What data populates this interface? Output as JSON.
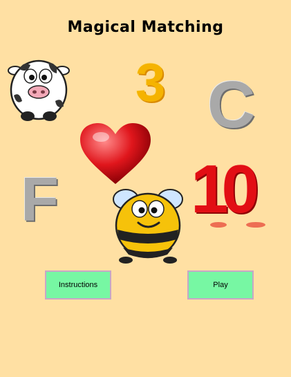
{
  "app": {
    "title": "Magical Matching"
  },
  "cards": {
    "number_three": "3",
    "letter_c": "C",
    "letter_f": "F",
    "number_ten": "10"
  },
  "buttons": {
    "instructions_label": "Instructions",
    "play_label": "Play"
  },
  "colors": {
    "background": "#ffe0a3",
    "button_fill": "#77f7a3",
    "button_border": "#c9a6c6"
  }
}
